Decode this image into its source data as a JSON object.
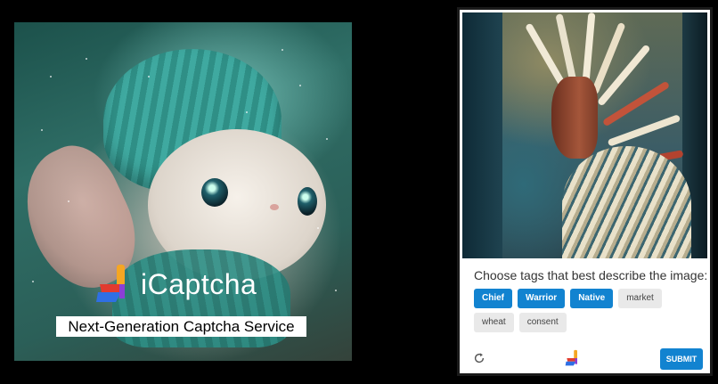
{
  "promo": {
    "brand_name": "iCaptcha",
    "tagline": "Next-Generation Captcha Service"
  },
  "captcha": {
    "prompt": "Choose tags that best describe the image:",
    "tags": [
      {
        "label": "Chief",
        "selected": true
      },
      {
        "label": "Warrior",
        "selected": true
      },
      {
        "label": "Native",
        "selected": true
      },
      {
        "label": "market",
        "selected": false
      },
      {
        "label": "wheat",
        "selected": false
      },
      {
        "label": "consent",
        "selected": false
      }
    ],
    "submit_label": "SUBMIT",
    "refresh_icon": "refresh-icon",
    "logo_icon": "icaptcha-logo-icon"
  },
  "colors": {
    "accent": "#1283d0",
    "tag_unselected_bg": "#e9e9e9",
    "logo_red": "#e23b2f",
    "logo_orange": "#f5a623",
    "logo_blue": "#2f6fe4",
    "logo_purple": "#8b3fd6"
  }
}
